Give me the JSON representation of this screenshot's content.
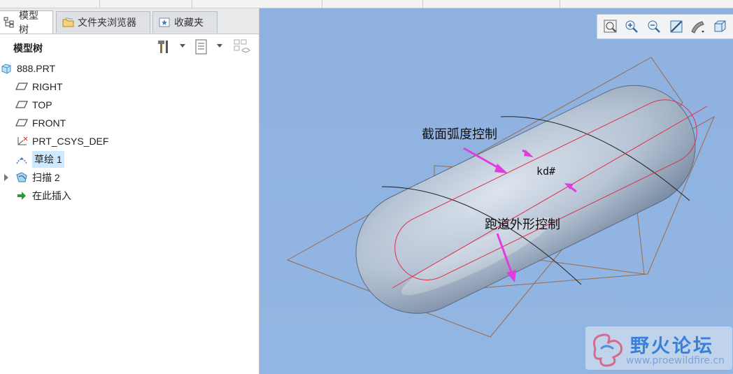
{
  "tabs": [
    {
      "label": "模型树",
      "icon": "model-tree-icon",
      "active": true
    },
    {
      "label": "文件夹浏览器",
      "icon": "folder-browser-icon",
      "active": false
    },
    {
      "label": "收藏夹",
      "icon": "favorites-icon",
      "active": false
    }
  ],
  "tree_toolbar": {
    "title": "模型树",
    "settings_icon": "tools-icon",
    "show_icon": "list-settings-icon",
    "filter_icon": "filter-icon"
  },
  "tree": {
    "root": "888.PRT",
    "items": [
      {
        "label": "RIGHT",
        "icon": "datum-plane-icon"
      },
      {
        "label": "TOP",
        "icon": "datum-plane-icon"
      },
      {
        "label": "FRONT",
        "icon": "datum-plane-icon"
      },
      {
        "label": "PRT_CSYS_DEF",
        "icon": "csys-icon"
      },
      {
        "label": "草绘 1",
        "icon": "sketch-icon",
        "selected": true
      },
      {
        "label": "扫描 2",
        "icon": "sweep-icon",
        "expandable": true
      },
      {
        "label": "在此插入",
        "icon": "insert-here-arrow-icon"
      }
    ]
  },
  "view_toolbar": [
    "zoom-fit-icon",
    "zoom-in-icon",
    "zoom-out-icon",
    "repaint-icon",
    "display-style-icon",
    "saved-view-icon"
  ],
  "viewport": {
    "annotations": {
      "section_arc": "截面弧度控制",
      "kd": "kd#",
      "track_shape": "跑道外形控制"
    },
    "colors": {
      "background": "#8fb1e0",
      "body": "#b9c6d6",
      "curve": "#e0304a",
      "arrow": "#e23be0",
      "plane": "#9a6b4a"
    }
  },
  "watermark": {
    "text": "野火论坛",
    "url": "www.proewildfire.cn"
  }
}
